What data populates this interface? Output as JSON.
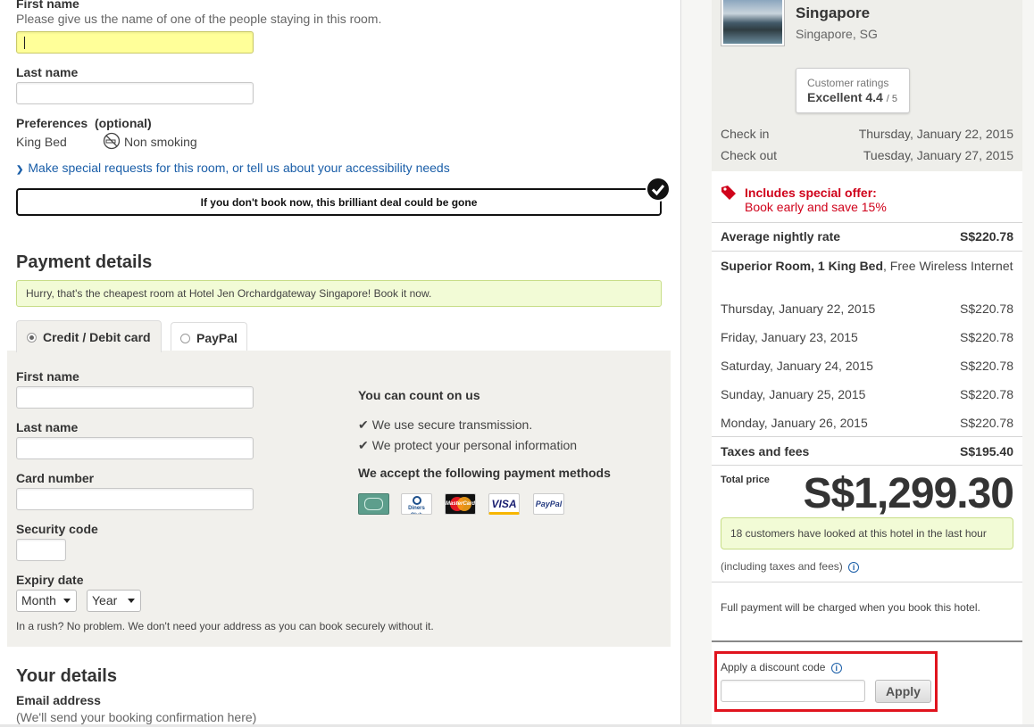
{
  "guest": {
    "first_name_label": "First name",
    "first_name_hint": "Please give us the name of one of the people staying in this room.",
    "first_name_value": "",
    "last_name_label": "Last name",
    "last_name_value": "",
    "preferences_label": "Preferences  (optional)",
    "bed": "King Bed",
    "smoking": "Non smoking",
    "special_requests_link": "Make special requests for this room, or tell us about your accessibility needs",
    "urgency_banner": "If you don't book now, this brilliant deal could be gone"
  },
  "payment": {
    "title": "Payment details",
    "cheapest_notice": "Hurry, that's the cheapest room at Hotel Jen Orchardgateway Singapore! Book it now.",
    "tabs": [
      {
        "label": "Credit / Debit card",
        "selected": true
      },
      {
        "label": "PayPal",
        "selected": false
      }
    ],
    "first_name_label": "First name",
    "last_name_label": "Last name",
    "card_number_label": "Card number",
    "security_code_label": "Security code",
    "expiry_label": "Expiry date",
    "month_value": "Month",
    "year_value": "Year",
    "no_address_note": "In a rush? No problem. We don't need your address as you can book securely without it.",
    "trust_title": "You can count on us",
    "trust_items": [
      "We use secure transmission.",
      "We protect your personal information"
    ],
    "methods_title": "We accept the following payment methods",
    "methods": [
      "American Express",
      "Diners Club",
      "MasterCard",
      "VISA",
      "PayPal"
    ],
    "method_marks": [
      "",
      "Diners Club",
      "MasterCard",
      "VISA",
      "PayPal"
    ]
  },
  "your_details": {
    "title": "Your details",
    "email_label": "Email address",
    "email_hint": "(We'll send your booking confirmation here)"
  },
  "summary": {
    "hotel_city_line": "Singapore",
    "location": "Singapore, SG",
    "rating_label": "Customer ratings",
    "rating_word": "Excellent",
    "rating_score": "4.4",
    "rating_max": "/ 5",
    "check_in_label": "Check in",
    "check_in_date": "Thursday, January 22, 2015",
    "check_out_label": "Check out",
    "check_out_date": "Tuesday, January 27, 2015",
    "offer_title": "Includes special offer:",
    "offer_text": "Book early and save 15%",
    "avg_label": "Average nightly rate",
    "avg_value": "S$220.78",
    "room_name": "Superior Room, 1 King Bed",
    "room_extra": ", Free Wireless Internet",
    "nights": [
      {
        "date": "Thursday, January 22, 2015",
        "price": "S$220.78"
      },
      {
        "date": "Friday, January 23, 2015",
        "price": "S$220.78"
      },
      {
        "date": "Saturday, January 24, 2015",
        "price": "S$220.78"
      },
      {
        "date": "Sunday, January 25, 2015",
        "price": "S$220.78"
      },
      {
        "date": "Monday, January 26, 2015",
        "price": "S$220.78"
      }
    ],
    "taxes_label": "Taxes and fees",
    "taxes_value": "S$195.40",
    "total_label": "Total price",
    "total_value": "S$1,299.30",
    "looked_notice": "18 customers have looked at this hotel in the last hour",
    "incl_taxes": "(including taxes and fees)",
    "full_payment_note": "Full payment will be charged when you book this hotel.",
    "discount_label": "Apply a discount code",
    "discount_value": "",
    "apply_label": "Apply"
  },
  "colors": {
    "highlight_field": "#ffff99",
    "link_blue": "#1a5ea8",
    "notice_green_bg": "#f2fbd6",
    "notice_green_border": "#c7dd86",
    "offer_red": "#d0021b",
    "discount_box_red": "#e0141e"
  }
}
